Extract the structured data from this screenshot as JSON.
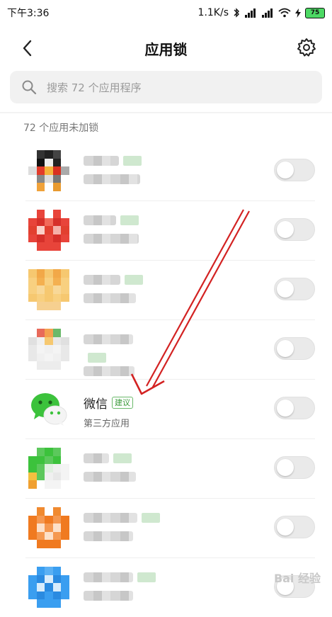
{
  "status": {
    "time": "下午3:36",
    "speed": "1.1K/s",
    "battery": "75"
  },
  "header": {
    "title": "应用锁"
  },
  "search": {
    "placeholder": "搜索 72 个应用程序"
  },
  "section": {
    "label": "72 个应用未加锁"
  },
  "apps": {
    "wechat": {
      "name": "微信",
      "badge": "建议",
      "subtitle": "第三方应用"
    }
  },
  "watermark": "Bai 经验",
  "colors": {
    "arrow": "#d32222",
    "badge_green": "#3a9a3a",
    "wechat_green": "#3cc23c"
  }
}
